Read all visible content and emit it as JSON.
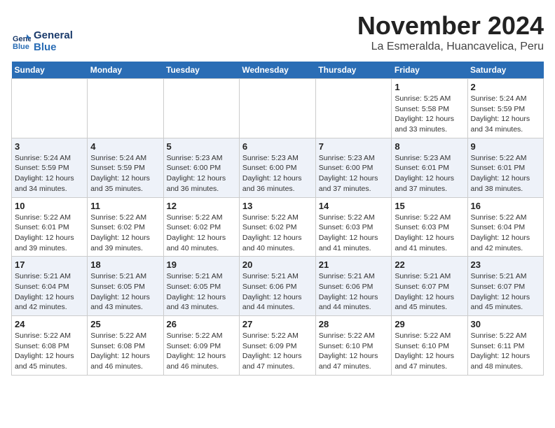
{
  "app": {
    "logo_line1": "General",
    "logo_line2": "Blue"
  },
  "header": {
    "month_title": "November 2024",
    "subtitle": "La Esmeralda, Huancavelica, Peru"
  },
  "weekdays": [
    "Sunday",
    "Monday",
    "Tuesday",
    "Wednesday",
    "Thursday",
    "Friday",
    "Saturday"
  ],
  "weeks": [
    [
      {
        "day": "",
        "info": ""
      },
      {
        "day": "",
        "info": ""
      },
      {
        "day": "",
        "info": ""
      },
      {
        "day": "",
        "info": ""
      },
      {
        "day": "",
        "info": ""
      },
      {
        "day": "1",
        "info": "Sunrise: 5:25 AM\nSunset: 5:58 PM\nDaylight: 12 hours\nand 33 minutes."
      },
      {
        "day": "2",
        "info": "Sunrise: 5:24 AM\nSunset: 5:59 PM\nDaylight: 12 hours\nand 34 minutes."
      }
    ],
    [
      {
        "day": "3",
        "info": "Sunrise: 5:24 AM\nSunset: 5:59 PM\nDaylight: 12 hours\nand 34 minutes."
      },
      {
        "day": "4",
        "info": "Sunrise: 5:24 AM\nSunset: 5:59 PM\nDaylight: 12 hours\nand 35 minutes."
      },
      {
        "day": "5",
        "info": "Sunrise: 5:23 AM\nSunset: 6:00 PM\nDaylight: 12 hours\nand 36 minutes."
      },
      {
        "day": "6",
        "info": "Sunrise: 5:23 AM\nSunset: 6:00 PM\nDaylight: 12 hours\nand 36 minutes."
      },
      {
        "day": "7",
        "info": "Sunrise: 5:23 AM\nSunset: 6:00 PM\nDaylight: 12 hours\nand 37 minutes."
      },
      {
        "day": "8",
        "info": "Sunrise: 5:23 AM\nSunset: 6:01 PM\nDaylight: 12 hours\nand 37 minutes."
      },
      {
        "day": "9",
        "info": "Sunrise: 5:22 AM\nSunset: 6:01 PM\nDaylight: 12 hours\nand 38 minutes."
      }
    ],
    [
      {
        "day": "10",
        "info": "Sunrise: 5:22 AM\nSunset: 6:01 PM\nDaylight: 12 hours\nand 39 minutes."
      },
      {
        "day": "11",
        "info": "Sunrise: 5:22 AM\nSunset: 6:02 PM\nDaylight: 12 hours\nand 39 minutes."
      },
      {
        "day": "12",
        "info": "Sunrise: 5:22 AM\nSunset: 6:02 PM\nDaylight: 12 hours\nand 40 minutes."
      },
      {
        "day": "13",
        "info": "Sunrise: 5:22 AM\nSunset: 6:02 PM\nDaylight: 12 hours\nand 40 minutes."
      },
      {
        "day": "14",
        "info": "Sunrise: 5:22 AM\nSunset: 6:03 PM\nDaylight: 12 hours\nand 41 minutes."
      },
      {
        "day": "15",
        "info": "Sunrise: 5:22 AM\nSunset: 6:03 PM\nDaylight: 12 hours\nand 41 minutes."
      },
      {
        "day": "16",
        "info": "Sunrise: 5:22 AM\nSunset: 6:04 PM\nDaylight: 12 hours\nand 42 minutes."
      }
    ],
    [
      {
        "day": "17",
        "info": "Sunrise: 5:21 AM\nSunset: 6:04 PM\nDaylight: 12 hours\nand 42 minutes."
      },
      {
        "day": "18",
        "info": "Sunrise: 5:21 AM\nSunset: 6:05 PM\nDaylight: 12 hours\nand 43 minutes."
      },
      {
        "day": "19",
        "info": "Sunrise: 5:21 AM\nSunset: 6:05 PM\nDaylight: 12 hours\nand 43 minutes."
      },
      {
        "day": "20",
        "info": "Sunrise: 5:21 AM\nSunset: 6:06 PM\nDaylight: 12 hours\nand 44 minutes."
      },
      {
        "day": "21",
        "info": "Sunrise: 5:21 AM\nSunset: 6:06 PM\nDaylight: 12 hours\nand 44 minutes."
      },
      {
        "day": "22",
        "info": "Sunrise: 5:21 AM\nSunset: 6:07 PM\nDaylight: 12 hours\nand 45 minutes."
      },
      {
        "day": "23",
        "info": "Sunrise: 5:21 AM\nSunset: 6:07 PM\nDaylight: 12 hours\nand 45 minutes."
      }
    ],
    [
      {
        "day": "24",
        "info": "Sunrise: 5:22 AM\nSunset: 6:08 PM\nDaylight: 12 hours\nand 45 minutes."
      },
      {
        "day": "25",
        "info": "Sunrise: 5:22 AM\nSunset: 6:08 PM\nDaylight: 12 hours\nand 46 minutes."
      },
      {
        "day": "26",
        "info": "Sunrise: 5:22 AM\nSunset: 6:09 PM\nDaylight: 12 hours\nand 46 minutes."
      },
      {
        "day": "27",
        "info": "Sunrise: 5:22 AM\nSunset: 6:09 PM\nDaylight: 12 hours\nand 47 minutes."
      },
      {
        "day": "28",
        "info": "Sunrise: 5:22 AM\nSunset: 6:10 PM\nDaylight: 12 hours\nand 47 minutes."
      },
      {
        "day": "29",
        "info": "Sunrise: 5:22 AM\nSunset: 6:10 PM\nDaylight: 12 hours\nand 47 minutes."
      },
      {
        "day": "30",
        "info": "Sunrise: 5:22 AM\nSunset: 6:11 PM\nDaylight: 12 hours\nand 48 minutes."
      }
    ]
  ]
}
